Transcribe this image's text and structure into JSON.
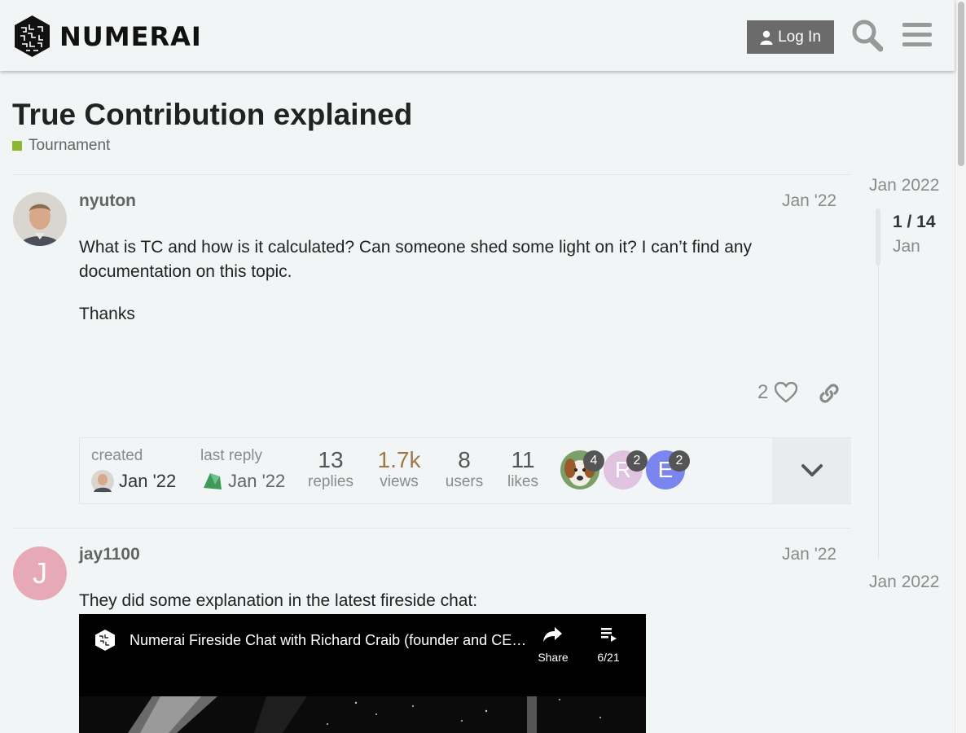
{
  "header": {
    "brand": "NUMERAI",
    "login_label": "Log In"
  },
  "topic": {
    "title": "True Contribution explained",
    "category": "Tournament",
    "category_color": "#8cb731"
  },
  "posts": [
    {
      "username": "nyuton",
      "date": "Jan '22",
      "paragraphs": [
        "What is TC and how is it calculated? Can someone shed some light on it? I can’t find any documentation on this topic.",
        "Thanks"
      ],
      "likes": "2"
    },
    {
      "username": "jay1100",
      "avatar_letter": "J",
      "avatar_color": "#e7a9b6",
      "date": "Jan '22",
      "paragraphs": [
        "They did some explanation in the latest fireside chat:"
      ]
    }
  ],
  "topic_map": {
    "created_label": "created",
    "created_date": "Jan '22",
    "last_reply_label": "last reply",
    "last_reply_date": "Jan '22",
    "replies": "13",
    "replies_label": "replies",
    "views": "1.7k",
    "views_label": "views",
    "views_color": "#9c7a48",
    "users": "8",
    "users_label": "users",
    "likes": "11",
    "likes_label": "likes",
    "participants": [
      {
        "letter": "",
        "count": "4",
        "color": "#7a6a55"
      },
      {
        "letter": "R",
        "count": "2",
        "color": "#e0c3e0"
      },
      {
        "letter": "E",
        "count": "2",
        "color": "#7a86ee"
      }
    ]
  },
  "timeline": {
    "top_date": "Jan 2022",
    "count": "1 / 14",
    "month": "Jan",
    "bottom_date": "Jan 2022"
  },
  "video": {
    "title": "Numerai Fireside Chat with Richard Craib (founder and CEO of Numerai)",
    "share_label": "Share",
    "playlist_label": "6/21"
  }
}
